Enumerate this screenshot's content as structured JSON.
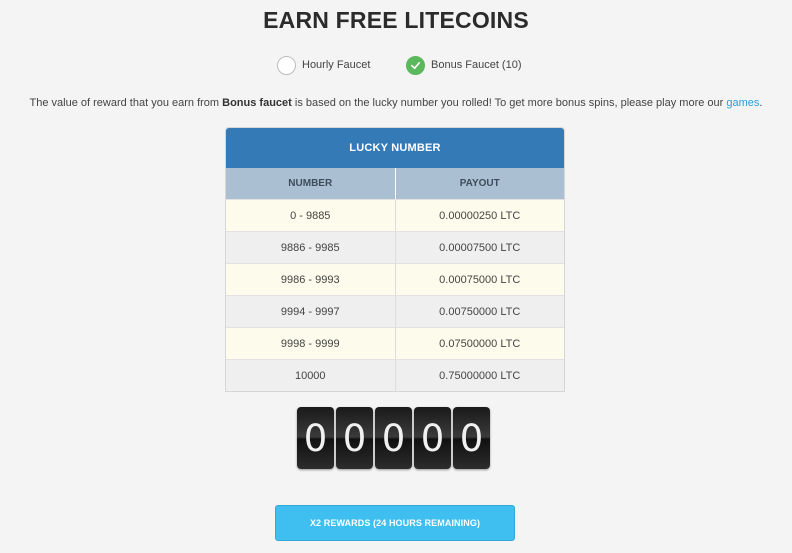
{
  "page_title": "EARN FREE LITECOINS",
  "faucet_options": {
    "hourly_label": "Hourly Faucet",
    "bonus_label": "Bonus Faucet (10)",
    "selected": "bonus"
  },
  "description": {
    "pre": "The value of reward that you earn from ",
    "bold": "Bonus faucet",
    "post": " is based on the lucky number you rolled! To get more bonus spins, please play more our ",
    "link": "games",
    "end": "."
  },
  "lucky_table": {
    "title": "LUCKY NUMBER",
    "col_number": "NUMBER",
    "col_payout": "PAYOUT",
    "rows": [
      {
        "number": "0 - 9885",
        "payout": "0.00000250 LTC"
      },
      {
        "number": "9886 - 9985",
        "payout": "0.00007500 LTC"
      },
      {
        "number": "9986 - 9993",
        "payout": "0.00075000 LTC"
      },
      {
        "number": "9994 - 9997",
        "payout": "0.00750000 LTC"
      },
      {
        "number": "9998 - 9999",
        "payout": "0.07500000 LTC"
      },
      {
        "number": "10000",
        "payout": "0.75000000 LTC"
      }
    ]
  },
  "roll_digits": [
    "0",
    "0",
    "0",
    "0",
    "0"
  ],
  "reward_button": "X2 REWARDS (24 HOURS REMAINING)",
  "colors": {
    "header_blue": "#337ab7",
    "check_green": "#5cb85c",
    "link_blue": "#2a9fd6",
    "button_cyan": "#3fbff0"
  }
}
